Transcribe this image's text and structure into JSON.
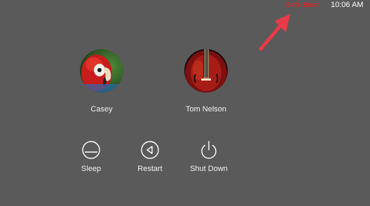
{
  "status": {
    "safe_boot_label": "Safe Boot",
    "time": "10:06 AM"
  },
  "annotation_arrow": {
    "color": "#e83a48"
  },
  "users": [
    {
      "name": "Casey",
      "avatar_icon": "parrot-avatar"
    },
    {
      "name": "Tom Nelson",
      "avatar_icon": "violin-avatar"
    }
  ],
  "actions": [
    {
      "label": "Sleep",
      "icon": "sleep-icon"
    },
    {
      "label": "Restart",
      "icon": "restart-icon"
    },
    {
      "label": "Shut Down",
      "icon": "power-icon"
    }
  ],
  "colors": {
    "background": "#5a5a5a",
    "safe_boot": "#e0262a",
    "text": "#ffffff"
  }
}
